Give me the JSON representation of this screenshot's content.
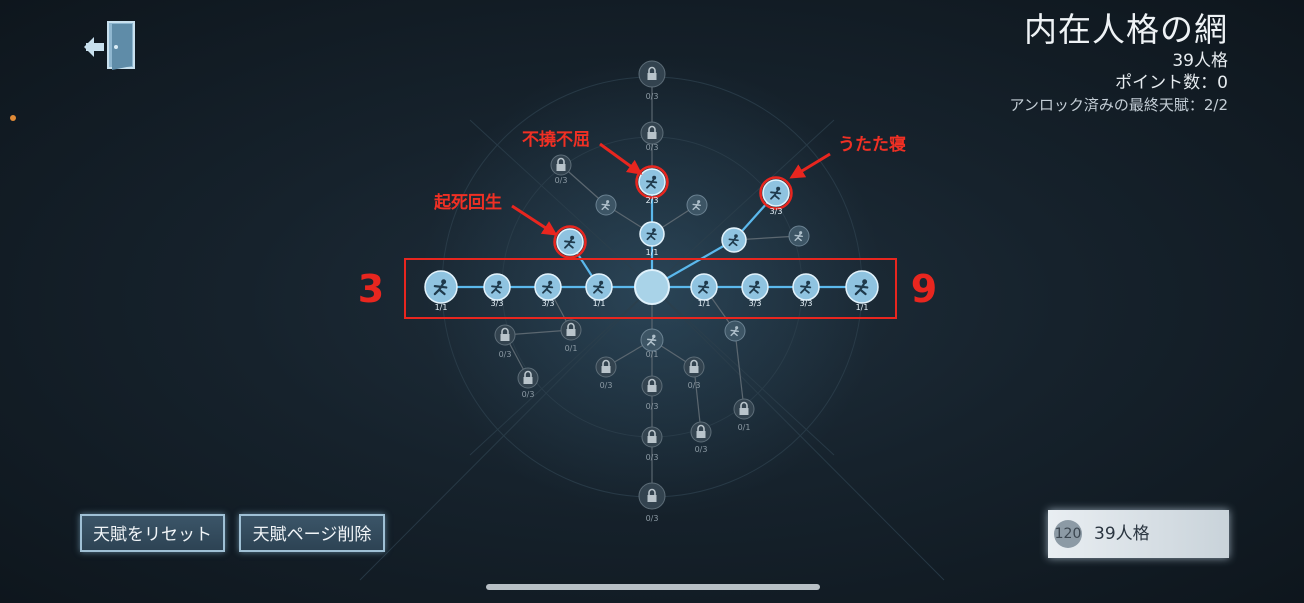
{
  "header": {
    "title": "内在人格の網",
    "persona_count": "39人格",
    "points": "ポイント数：0",
    "final_talents": "アンロック済みの最終天賦：2/2"
  },
  "buttons": {
    "reset": "天賦をリセット",
    "delete_page": "天賦ページ削除"
  },
  "persona_box": {
    "cost": "120",
    "label": "39人格"
  },
  "annotations": {
    "left_number": "3",
    "right_number": "9",
    "labels": [
      "起死回生",
      "不撓不屈",
      "うたた寝"
    ],
    "color": "#e8261f"
  },
  "colors": {
    "node_active": "#8fc3e0",
    "node_locked": "#33434f",
    "line_active": "#5bb8ec",
    "line_locked": "#5b6770"
  },
  "talent_nodes": [
    {
      "state": "center",
      "label": ""
    },
    {
      "state": "active",
      "icon": "running-figure-icon",
      "label": "1/1"
    },
    {
      "state": "active",
      "icon": "leaping-figure-icon",
      "label": "3/3"
    },
    {
      "state": "active",
      "icon": "dashing-figure-icon",
      "label": "3/3"
    },
    {
      "state": "active",
      "icon": "vaulting-figure-icon",
      "label": "1/1"
    },
    {
      "state": "active",
      "icon": "kneeling-figure-icon",
      "label": "1/1"
    },
    {
      "state": "active",
      "icon": "jumping-figure-icon",
      "label": "3/3"
    },
    {
      "state": "active",
      "icon": "head-icon",
      "label": "3/3"
    },
    {
      "state": "active",
      "icon": "struggling-figure-icon",
      "label": "1/1"
    },
    {
      "state": "active",
      "icon": "hammer-icon",
      "label": "1/1"
    },
    {
      "state": "active",
      "icon": "figure-icon",
      "label": ""
    },
    {
      "state": "active",
      "icon": "borrowed-time-icon",
      "label": ""
    },
    {
      "state": "active",
      "icon": "tide-turner-icon",
      "label": "2/3"
    },
    {
      "state": "active",
      "icon": "nap-icon",
      "label": "3/3"
    },
    {
      "state": "dim",
      "icon": "swirl-icon",
      "label": ""
    },
    {
      "state": "dim",
      "icon": "box-icon",
      "label": ""
    },
    {
      "state": "dim",
      "icon": "gear-icon",
      "label": ""
    },
    {
      "state": "locked",
      "label": "0/3"
    },
    {
      "state": "locked",
      "label": "0/3"
    },
    {
      "state": "locked",
      "label": "0/3"
    },
    {
      "state": "locked",
      "label": "0/1"
    },
    {
      "state": "locked",
      "label": "0/3"
    },
    {
      "state": "dim",
      "icon": "hand-icon",
      "label": "0/1"
    },
    {
      "state": "locked",
      "label": "0/3"
    },
    {
      "state": "dim",
      "icon": "mask-icon",
      "label": ""
    },
    {
      "state": "locked",
      "label": "0/3"
    },
    {
      "state": "locked",
      "label": "0/3"
    },
    {
      "state": "locked",
      "label": "0/3"
    },
    {
      "state": "locked",
      "label": "0/1"
    },
    {
      "state": "locked",
      "label": "0/3"
    },
    {
      "state": "locked",
      "label": "0/3"
    },
    {
      "state": "locked",
      "label": "0/3"
    },
    {
      "state": "dim",
      "icon": "eye-icon",
      "label": "0/1"
    },
    {
      "state": "locked",
      "label": "0/3"
    },
    {
      "state": "locked",
      "label": "0/3"
    }
  ]
}
